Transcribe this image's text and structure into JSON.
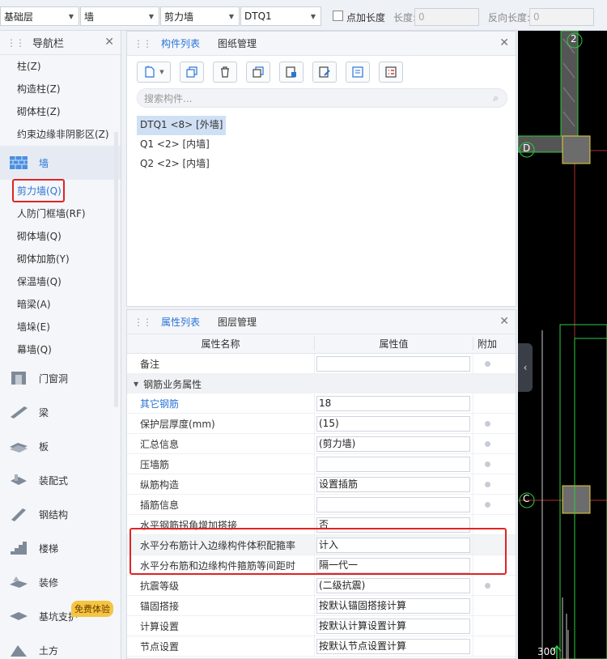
{
  "toolbar": {
    "floor": "基础层",
    "category": "墙",
    "type": "剪力墙",
    "component": "DTQ1",
    "point_length_label": "点加长度",
    "length_label": "长度:",
    "length_value": "0",
    "reverse_length_label": "反向长度:",
    "reverse_length_value": "0"
  },
  "nav": {
    "title": "导航栏",
    "items_top": [
      "柱(Z)",
      "构造柱(Z)",
      "砌体柱(Z)",
      "约束边缘非阴影区(Z)"
    ],
    "wall_category": "墙",
    "wall_items": [
      "剪力墙(Q)",
      "人防门框墙(RF)",
      "砌体墙(Q)",
      "砌体加筋(Y)",
      "保温墙(Q)",
      "暗梁(A)",
      "墙垛(E)",
      "幕墙(Q)"
    ],
    "categories": [
      "门窗洞",
      "梁",
      "板",
      "装配式",
      "钢结构",
      "楼梯",
      "装修",
      "基坑支护",
      "土方"
    ],
    "badge": "免费体验"
  },
  "component_panel": {
    "tab_active": "构件列表",
    "tab_other": "图纸管理",
    "search_placeholder": "搜索构件...",
    "items": [
      "DTQ1 <8> [外墙]",
      "Q1 <2> [内墙]",
      "Q2 <2> [内墙]"
    ]
  },
  "property_panel": {
    "tab_active": "属性列表",
    "tab_other": "图层管理",
    "col_name": "属性名称",
    "col_value": "属性值",
    "col_extra": "附加",
    "row_note": {
      "name": "备注",
      "value": ""
    },
    "group_label": "钢筋业务属性",
    "rows": [
      {
        "name": "其它钢筋",
        "value": "18"
      },
      {
        "name": "保护层厚度(mm)",
        "value": "(15)"
      },
      {
        "name": "汇总信息",
        "value": "(剪力墙)"
      },
      {
        "name": "压墙筋",
        "value": ""
      },
      {
        "name": "纵筋构造",
        "value": "设置插筋"
      },
      {
        "name": "插筋信息",
        "value": ""
      },
      {
        "name": "水平钢筋拐角增加搭接",
        "value": "否"
      },
      {
        "name": "水平分布筋计入边缘构件体积配箍率",
        "value": "计入"
      },
      {
        "name": "水平分布筋和边缘构件箍筋等间距时",
        "value": "隔一代一"
      },
      {
        "name": "抗震等级",
        "value": "(二级抗震)"
      },
      {
        "name": "锚固搭接",
        "value": "按默认锚固搭接计算"
      },
      {
        "name": "计算设置",
        "value": "按默认计算设置计算"
      },
      {
        "name": "节点设置",
        "value": "按默认节点设置计算"
      }
    ]
  },
  "cad": {
    "axis_2": "2",
    "axis_d": "D",
    "axis_c": "C",
    "dim_300": "300"
  }
}
